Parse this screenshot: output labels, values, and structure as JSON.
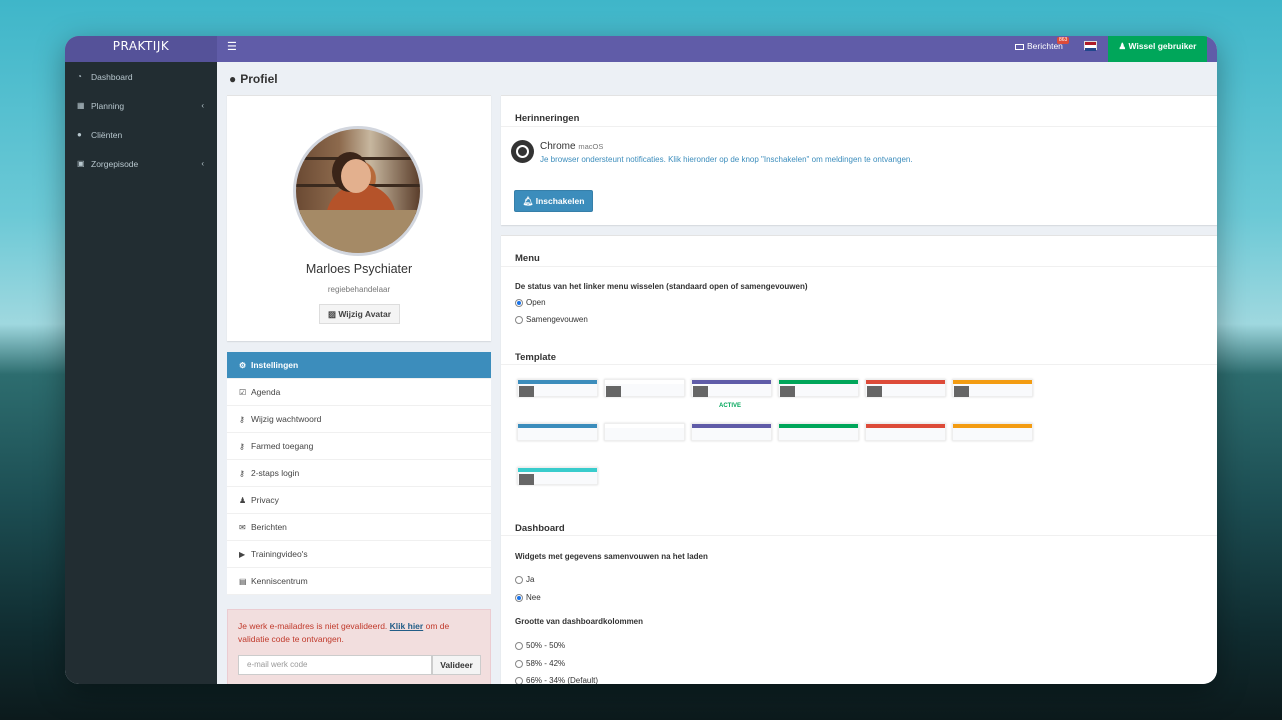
{
  "topbar": {
    "logo": "PRAKTIJK",
    "messages_label": "Berichten",
    "messages_badge": "863",
    "switch_user_label": "Wissel gebruiker"
  },
  "sidebar": {
    "items": [
      {
        "label": "Dashboard",
        "icon": "dashboard-icon"
      },
      {
        "label": "Planning",
        "icon": "calendar-icon"
      },
      {
        "label": "Cliënten",
        "icon": "user-icon"
      },
      {
        "label": "Zorgepisode",
        "icon": "medkit-icon"
      }
    ]
  },
  "page": {
    "title": "Profiel"
  },
  "profile": {
    "name": "Marloes Psychiater",
    "role": "regiebehandelaar",
    "change_avatar_label": "Wijzig Avatar"
  },
  "profile_menu": {
    "items": [
      {
        "label": "Instellingen",
        "active": true
      },
      {
        "label": "Agenda"
      },
      {
        "label": "Wijzig wachtwoord"
      },
      {
        "label": "Farmed toegang"
      },
      {
        "label": "2-staps login"
      },
      {
        "label": "Privacy"
      },
      {
        "label": "Berichten"
      },
      {
        "label": "Trainingvideo's"
      },
      {
        "label": "Kenniscentrum"
      }
    ]
  },
  "email_alert": {
    "text_before": "Je werk e-mailadres is niet gevalideerd.",
    "link": "Klik hier",
    "text_after": "om de validatie code te ontvangen.",
    "placeholder": "e-mail werk code",
    "button": "Valideer"
  },
  "reminders": {
    "title": "Herinneringen",
    "browser": "Chrome",
    "os": "macOS",
    "note": "Je browser ondersteunt notificaties. Klik hieronder op de knop \"Inschakelen\" om meldingen te ontvangen.",
    "enable_label": "Inschakelen"
  },
  "menu_settings": {
    "title": "Menu",
    "question": "De status van het linker menu wisselen (standaard open of samengevouwen)",
    "options": [
      {
        "label": "Open",
        "checked": true
      },
      {
        "label": "Samengevouwen",
        "checked": false
      }
    ]
  },
  "template": {
    "title": "Template",
    "active_label": "ACTIVE",
    "skin_colors": [
      "#3c8dbc",
      "#ffffff",
      "#605ca8",
      "#00a65a",
      "#dd4b39",
      "#f39c12",
      "#3c8dbc",
      "#ffffff",
      "#605ca8",
      "#00a65a",
      "#dd4b39",
      "#f39c12",
      "#39cccc"
    ]
  },
  "dashboard_settings": {
    "title": "Dashboard",
    "widgets_question": "Widgets met gegevens samenvouwen na het laden",
    "widgets_options": [
      {
        "label": "Ja",
        "checked": false
      },
      {
        "label": "Nee",
        "checked": true
      }
    ],
    "columns_question": "Grootte van dashboardkolommen",
    "columns_options": [
      {
        "label": "50% - 50%",
        "checked": false
      },
      {
        "label": "58% - 42%",
        "checked": false
      },
      {
        "label": "66% - 34% (Default)",
        "checked": false
      }
    ]
  }
}
